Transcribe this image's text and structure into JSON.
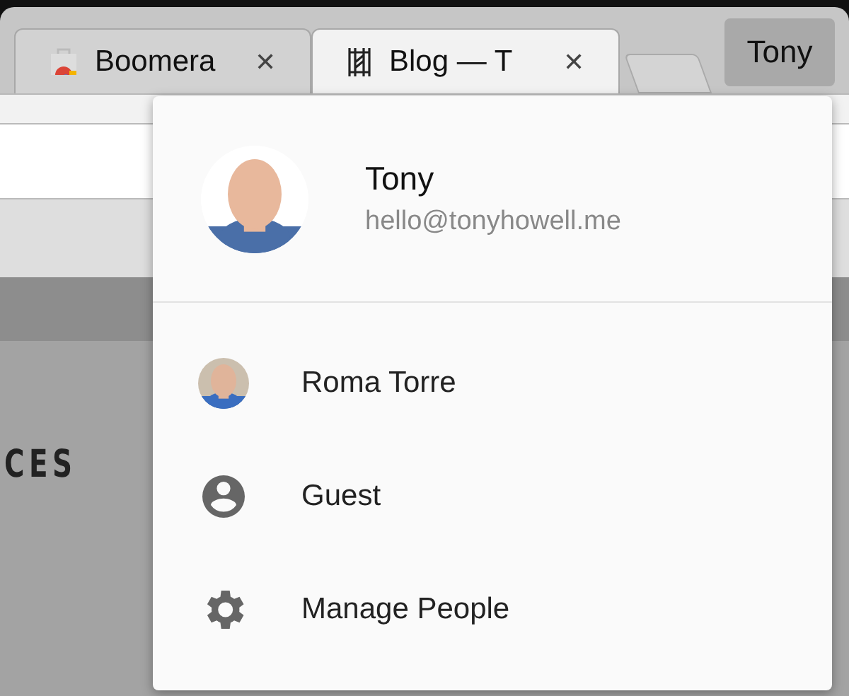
{
  "tabs": [
    {
      "kind": "store",
      "title": "Boomera",
      "close": "✕",
      "selected": false
    },
    {
      "kind": "site",
      "title": "Blog — T",
      "close": "✕",
      "selected": true
    }
  ],
  "profile_button": {
    "label": "Tony"
  },
  "page": {
    "nav_items": [
      "CES"
    ]
  },
  "profile_menu": {
    "user": {
      "name": "Tony",
      "email": "hello@tonyhowell.me"
    },
    "items": [
      {
        "kind": "person",
        "label": "Roma Torre"
      },
      {
        "kind": "guest",
        "label": "Guest"
      },
      {
        "kind": "settings",
        "label": "Manage People"
      }
    ]
  }
}
